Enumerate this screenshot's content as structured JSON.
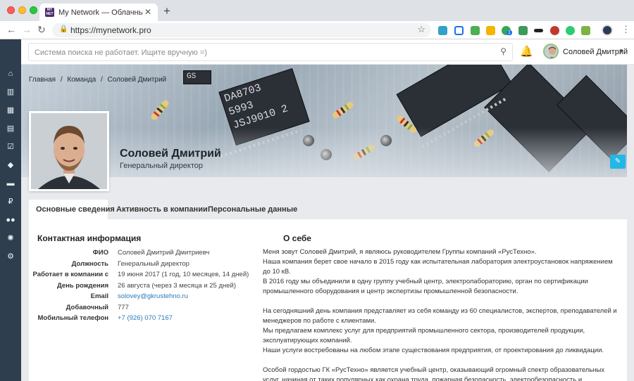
{
  "browser": {
    "tab_title": "My Network — Облачный корпоративный портал",
    "favicon_text": "MY NET",
    "url": "https://mynetwork.pro",
    "extension_badge": "1"
  },
  "sidebar": {
    "items": [
      {
        "icon": "home-icon"
      },
      {
        "icon": "bar-chart-icon"
      },
      {
        "icon": "table-icon"
      },
      {
        "icon": "calendar-icon"
      },
      {
        "icon": "checkbox-icon"
      },
      {
        "icon": "box-icon"
      },
      {
        "icon": "monitor-icon"
      },
      {
        "icon": "ruble-icon",
        "glyph": "₽"
      },
      {
        "icon": "users-icon"
      },
      {
        "icon": "lightbulb-icon"
      },
      {
        "icon": "gear-icon"
      }
    ]
  },
  "header": {
    "search_placeholder": "Система поиска не работает. Ищите вручную =)",
    "user_name": "Соловей Дмитрий"
  },
  "breadcrumb": [
    "Главная",
    "Команда",
    "Соловей Дмитрий"
  ],
  "cover_chips": [
    "DA8703",
    "5993",
    "JSJ9010 2",
    "GS"
  ],
  "profile": {
    "name": "Соловей Дмитрий",
    "position": "Генеральный директор"
  },
  "tabs": [
    "Основные сведения",
    "Активность в компании",
    "Персональные данные"
  ],
  "contact": {
    "heading": "Контактная информация",
    "rows": [
      {
        "label": "ФИО",
        "value": "Соловей Дмитрий Дмитриевч"
      },
      {
        "label": "Должность",
        "value": "Генеральный директор"
      },
      {
        "label": "Работает в компании с",
        "value": "19 июня 2017 (1 год, 10 месяцев, 14 дней)"
      },
      {
        "label": "День рождения",
        "value": "26 августа (через 3 месяца и 25 дней)"
      },
      {
        "label": "Email",
        "value": "solovey@gkrustehno.ru"
      },
      {
        "label": "Добавочный",
        "value": "777"
      },
      {
        "label": "Мобильный телефон",
        "value": "+7 (926) 070 7167"
      }
    ]
  },
  "about": {
    "heading": "О себе",
    "lines": [
      "Меня зовут Соловей Дмитрий, я являюсь руководителем Группы компаний «РусТехно».",
      "Наша компания берет свое начало в 2015 году как испытательная лаборатория электроустановок напряжением до 10 кВ.",
      "В 2016 году мы объединили в одну группу учебный центр, электролабораторию, орган по сертификации промышленного оборудования и центр экспертизы промышленной безопасности.",
      "",
      "На сегодняшний день компания представляет из себя команду из 60 специалистов, экспертов, преподавателей и менеджеров по работе с клиентами.",
      "Мы предлагаем комплекс услуг для предприятий промышленного сектора, производителей продукции, эксплуатирующих компаний.",
      "Наши услуги востребованы на любом этапе существования предприятия, от проектирования до ликвидации.",
      "",
      "Особой гордостью ГК «РусТехно» является учебный центр, оказывающий огромный спектр образовательных услуг, начиная от таких популярных как охрана труда, пожарная безопасность, электробезопасность и"
    ]
  },
  "colors": {
    "sidebar_bg": "#2e3e4e",
    "accent": "#23b7e5",
    "link": "#2a7ab8"
  }
}
